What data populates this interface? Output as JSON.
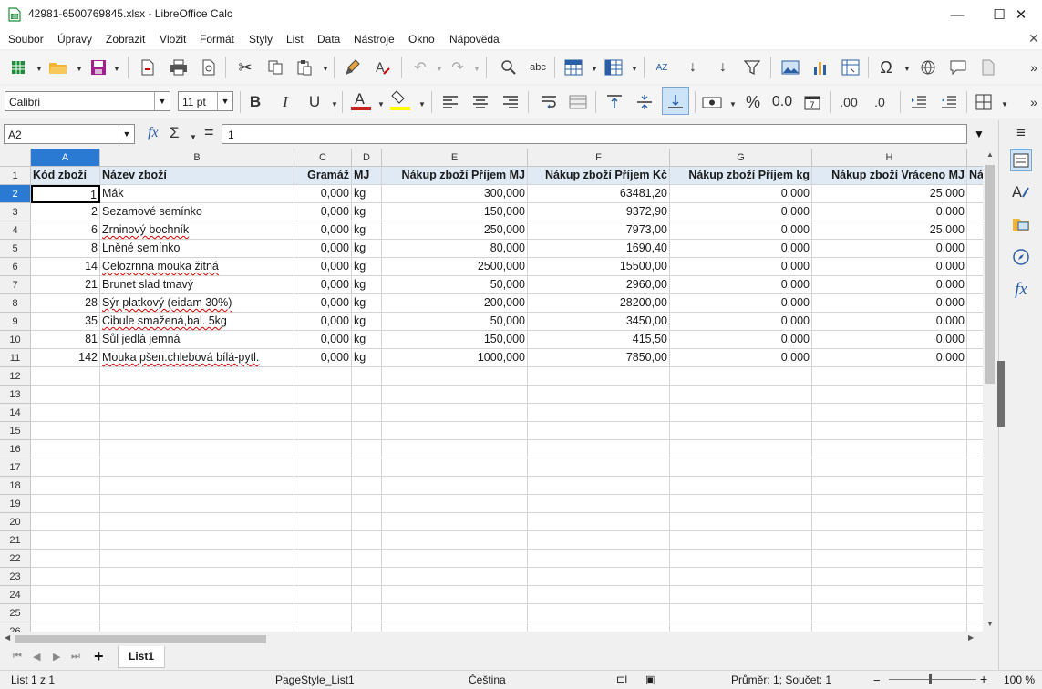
{
  "window": {
    "title": "42981-6500769845.xlsx - LibreOffice Calc",
    "minimize": "—",
    "maximize": "☐",
    "close": "✕"
  },
  "menu": [
    "Soubor",
    "Úpravy",
    "Zobrazit",
    "Vložit",
    "Formát",
    "Styly",
    "List",
    "Data",
    "Nástroje",
    "Okno",
    "Nápověda"
  ],
  "toolbar2": {
    "font_name": "Calibri",
    "font_size": "11 pt",
    "bold": "B",
    "italic": "I",
    "underline": "U",
    "percent": "%",
    "num_format": "0.0",
    "add_decimal": ".00",
    "del_decimal": ".0"
  },
  "formula_bar": {
    "name_box": "A2",
    "fx": "fx",
    "sum": "Σ",
    "equals": "=",
    "content": "1"
  },
  "columns": [
    {
      "letter": "A",
      "selected": true
    },
    {
      "letter": "B"
    },
    {
      "letter": "C"
    },
    {
      "letter": "D"
    },
    {
      "letter": "E"
    },
    {
      "letter": "F"
    },
    {
      "letter": "G"
    },
    {
      "letter": "H"
    },
    {
      "letter": ""
    }
  ],
  "header_row": [
    "Kód zboží",
    "Název zboží",
    "Gramáž",
    "MJ",
    "Nákup zboží Příjem MJ",
    "Nákup zboží Příjem Kč",
    "Nákup zboží Příjem kg",
    "Nákup zboží Vráceno MJ",
    "Ná"
  ],
  "rows": [
    [
      "1",
      "Mák",
      "0,000",
      "kg",
      "300,000",
      "63481,20",
      "0,000",
      "25,000"
    ],
    [
      "2",
      "Sezamové semínko",
      "0,000",
      "kg",
      "150,000",
      "9372,90",
      "0,000",
      "0,000"
    ],
    [
      "6",
      "Zrninový bochník",
      "0,000",
      "kg",
      "250,000",
      "7973,00",
      "0,000",
      "25,000"
    ],
    [
      "8",
      "Lněné semínko",
      "0,000",
      "kg",
      "80,000",
      "1690,40",
      "0,000",
      "0,000"
    ],
    [
      "14",
      "Celozrnna mouka žitná",
      "0,000",
      "kg",
      "2500,000",
      "15500,00",
      "0,000",
      "0,000"
    ],
    [
      "21",
      "Brunet  slad tmavý",
      "0,000",
      "kg",
      "50,000",
      "2960,00",
      "0,000",
      "0,000"
    ],
    [
      "28",
      "Sýr platkový (eidam 30%)",
      "0,000",
      "kg",
      "200,000",
      "28200,00",
      "0,000",
      "0,000"
    ],
    [
      "35",
      "Cibule smažená,bal. 5kg",
      "0,000",
      "kg",
      "50,000",
      "3450,00",
      "0,000",
      "0,000"
    ],
    [
      "81",
      "Sůl jedlá jemná",
      "0,000",
      "kg",
      "150,000",
      "415,50",
      "0,000",
      "0,000"
    ],
    [
      "142",
      "Mouka pšen.chlebová bílá-pytl.",
      "0,000",
      "kg",
      "1000,000",
      "7850,00",
      "0,000",
      "0,000"
    ]
  ],
  "row_numbers": [
    "1",
    "2",
    "3",
    "4",
    "5",
    "6",
    "7",
    "8",
    "9",
    "10",
    "11",
    "12",
    "13",
    "14",
    "15",
    "16",
    "17",
    "18",
    "19",
    "20",
    "21",
    "22",
    "23",
    "24",
    "25",
    "26"
  ],
  "sheet_tabs": {
    "add": "+",
    "active": "List1"
  },
  "status": {
    "sheet_pos": "List 1 z 1",
    "page_style": "PageStyle_List1",
    "language": "Čeština",
    "summary": "Průměr: 1; Součet: 1",
    "zoom": "100 %"
  }
}
